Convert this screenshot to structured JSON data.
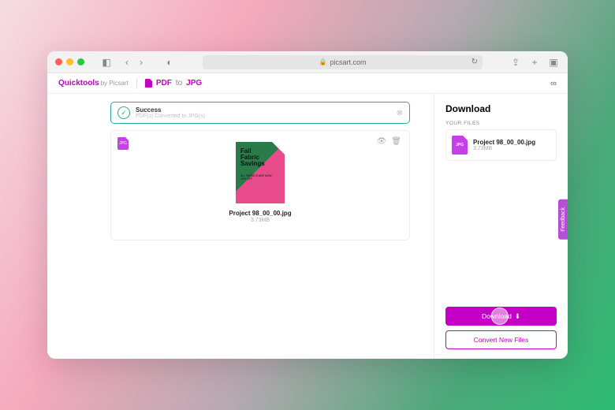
{
  "browser": {
    "url": "picsart.com"
  },
  "header": {
    "brand": "Quicktools",
    "brand_by": "by Picsart",
    "tool_from": "PDF",
    "tool_to_word": "to",
    "tool_to": "JPG"
  },
  "alert": {
    "title": "Success",
    "subtitle": "PDF(s) Converted to JPG(s)"
  },
  "file": {
    "badge": "JPG",
    "thumb_title_l1": "Fall",
    "thumb_title_l2": "Fabric",
    "thumb_title_l3": "Savings",
    "thumb_sub_l1": "ALL FABRICS ARE NOW",
    "thumb_sub_l2": "20% OFF",
    "name": "Project 98_00_00.jpg",
    "size": "3.73MB"
  },
  "sidebar": {
    "title": "Download",
    "your_files": "YOUR FILES",
    "file_badge": "JPG",
    "file_name": "Project 98_00_00.jpg",
    "file_size": "3.73MB",
    "feedback": "Feedback",
    "download_btn": "Download",
    "convert_btn": "Convert New Files"
  }
}
